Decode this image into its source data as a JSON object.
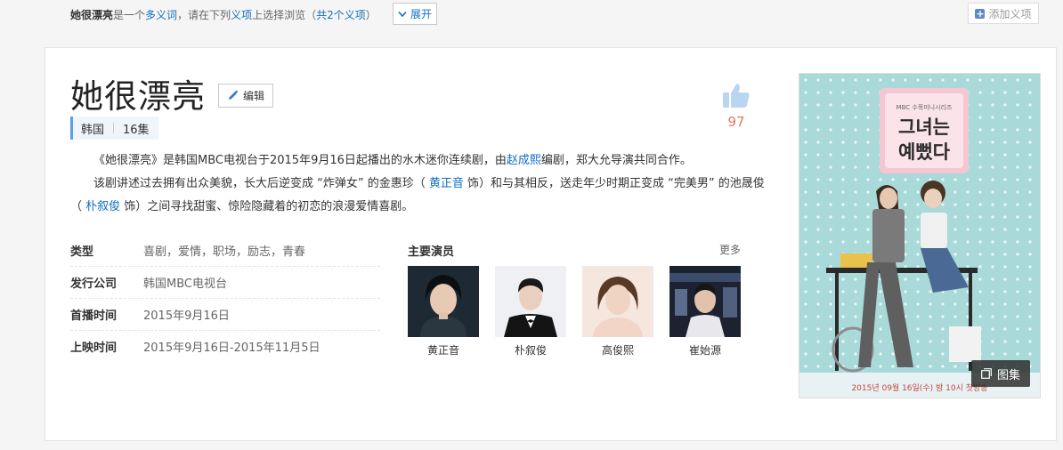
{
  "polysemy": {
    "term": "她很漂亮",
    "text1": "是一个",
    "link1": "多义词",
    "text2": "，请在下列",
    "link2": "义项",
    "text3": "上选择浏览（",
    "link3": "共2个义项",
    "text4": "）",
    "expand_label": "展开",
    "add_label": "添加义项"
  },
  "entry": {
    "title": "她很漂亮",
    "edit_label": "编辑",
    "tags": [
      "韩国",
      "16集"
    ],
    "likes": "97"
  },
  "summary": {
    "p1_a": "《她很漂亮》是韩国MBC电视台于2015年9月16日起播出的水木迷你连续剧，由",
    "p1_link": "赵成熙",
    "p1_b": "编剧，郑大允导演共同合作。",
    "p2_a": "该剧讲述过去拥有出众美貌，长大后逆变成 “炸弹女” 的金惠珍（ ",
    "p2_link1": "黄正音",
    "p2_b": " 饰）和与其相反，送走年少时期正变成 “完美男” 的池晟俊（ ",
    "p2_link2": "朴叙俊",
    "p2_c": " 饰）之间寻找甜蜜、惊险隐藏着的初恋的浪漫爱情喜剧。"
  },
  "basic_info": [
    {
      "key": "类型",
      "value": "喜剧，爱情，职场，励志，青春",
      "link": false
    },
    {
      "key": "发行公司",
      "value": "韩国MBC电视台",
      "link": true
    },
    {
      "key": "首播时间",
      "value": "2015年9月16日",
      "link": false
    },
    {
      "key": "上映时间",
      "value": "2015年9月16日-2015年11月5日",
      "link": false
    }
  ],
  "actors": {
    "heading": "主要演员",
    "more_label": "更多",
    "list": [
      "黄正音",
      "朴叙俊",
      "高俊熙",
      "崔始源"
    ]
  },
  "poster": {
    "logo_text": "MBC 수목미니시리즈",
    "title_line1": "그녀는",
    "title_line2": "예뻤다",
    "footer_text": "2015년 09월 16일(수) 밤 10시 첫방송",
    "gallery_label": "图集"
  }
}
